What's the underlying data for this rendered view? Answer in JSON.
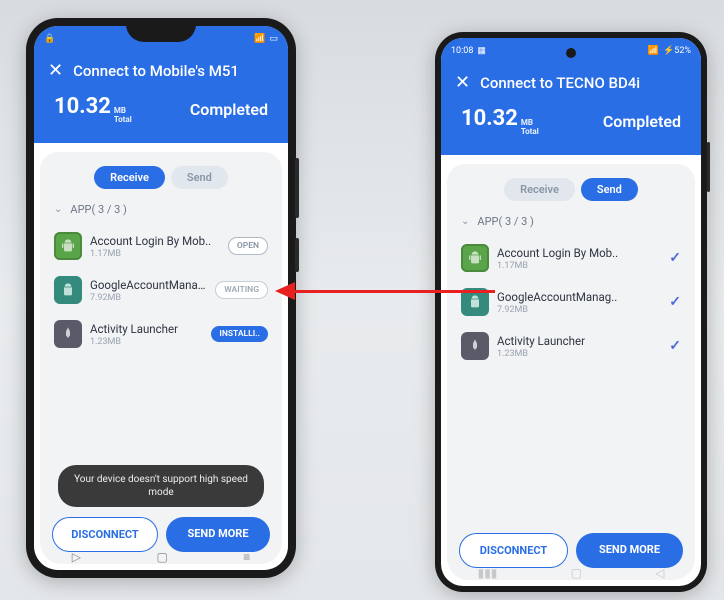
{
  "left": {
    "statusbar": {
      "time_hidden": "",
      "battery": "▢",
      "signal": "📶"
    },
    "back_icon": "✕",
    "title": "Connect to Mobile's M51",
    "size_value": "10.32",
    "size_unit_top": "MB",
    "size_unit_bottom": "Total",
    "status": "Completed",
    "tab_receive": "Receive",
    "tab_send": "Send",
    "section": "APP( 3 / 3 )",
    "apps": [
      {
        "name": "Account Login By Mob..",
        "size": "1.17MB",
        "badge": "OPEN",
        "badge_class": "badge-open"
      },
      {
        "name": "GoogleAccountManag..",
        "size": "7.92MB",
        "badge": "WAITING",
        "badge_class": "badge-waiting"
      },
      {
        "name": "Activity Launcher",
        "size": "1.23MB",
        "badge": "INSTALLI..",
        "badge_class": "badge-install"
      }
    ],
    "toast": "Your device doesn't support high speed mode",
    "btn_disconnect": "DISCONNECT",
    "btn_sendmore": "SEND MORE"
  },
  "right": {
    "statusbar": {
      "time": "10:08",
      "battery": "52%"
    },
    "back_icon": "✕",
    "title": "Connect to TECNO BD4i",
    "size_value": "10.32",
    "size_unit_top": "MB",
    "size_unit_bottom": "Total",
    "status": "Completed",
    "tab_receive": "Receive",
    "tab_send": "Send",
    "section": "APP( 3 / 3 )",
    "apps": [
      {
        "name": "Account Login By Mob..",
        "size": "1.17MB"
      },
      {
        "name": "GoogleAccountManag..",
        "size": "7.92MB"
      },
      {
        "name": "Activity Launcher",
        "size": "1.23MB"
      }
    ],
    "btn_disconnect": "DISCONNECT",
    "btn_sendmore": "SEND MORE"
  }
}
